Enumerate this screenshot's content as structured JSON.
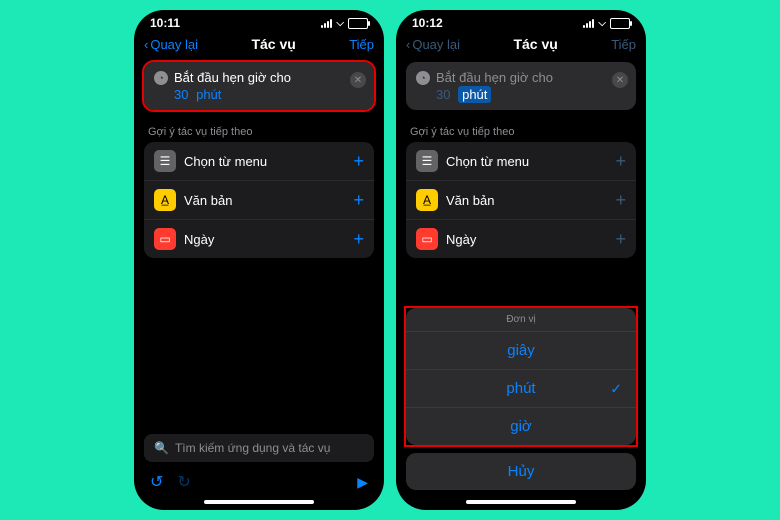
{
  "left": {
    "status_time": "10:11",
    "nav_back": "Quay lại",
    "nav_title": "Tác vụ",
    "nav_next": "Tiếp",
    "action_title": "Bắt đầu hẹn giờ cho",
    "action_value": "30",
    "action_unit": "phút",
    "section_label": "Gợi ý tác vụ tiếp theo",
    "suggestions": [
      {
        "label": "Chọn từ menu"
      },
      {
        "label": "Văn bản"
      },
      {
        "label": "Ngày"
      }
    ],
    "search_placeholder": "Tìm kiếm ứng dụng và tác vụ"
  },
  "right": {
    "status_time": "10:12",
    "nav_back": "Quay lại",
    "nav_title": "Tác vụ",
    "nav_next": "Tiếp",
    "action_title": "Bắt đầu hẹn giờ cho",
    "action_value": "30",
    "action_unit": "phút",
    "section_label": "Gợi ý tác vụ tiếp theo",
    "suggestions": [
      {
        "label": "Chọn từ menu"
      },
      {
        "label": "Văn bản"
      },
      {
        "label": "Ngày"
      }
    ],
    "sheet_title": "Đơn vị",
    "sheet_options": [
      {
        "label": "giây",
        "selected": false
      },
      {
        "label": "phút",
        "selected": true
      },
      {
        "label": "giờ",
        "selected": false
      }
    ],
    "cancel_label": "Hủy"
  }
}
